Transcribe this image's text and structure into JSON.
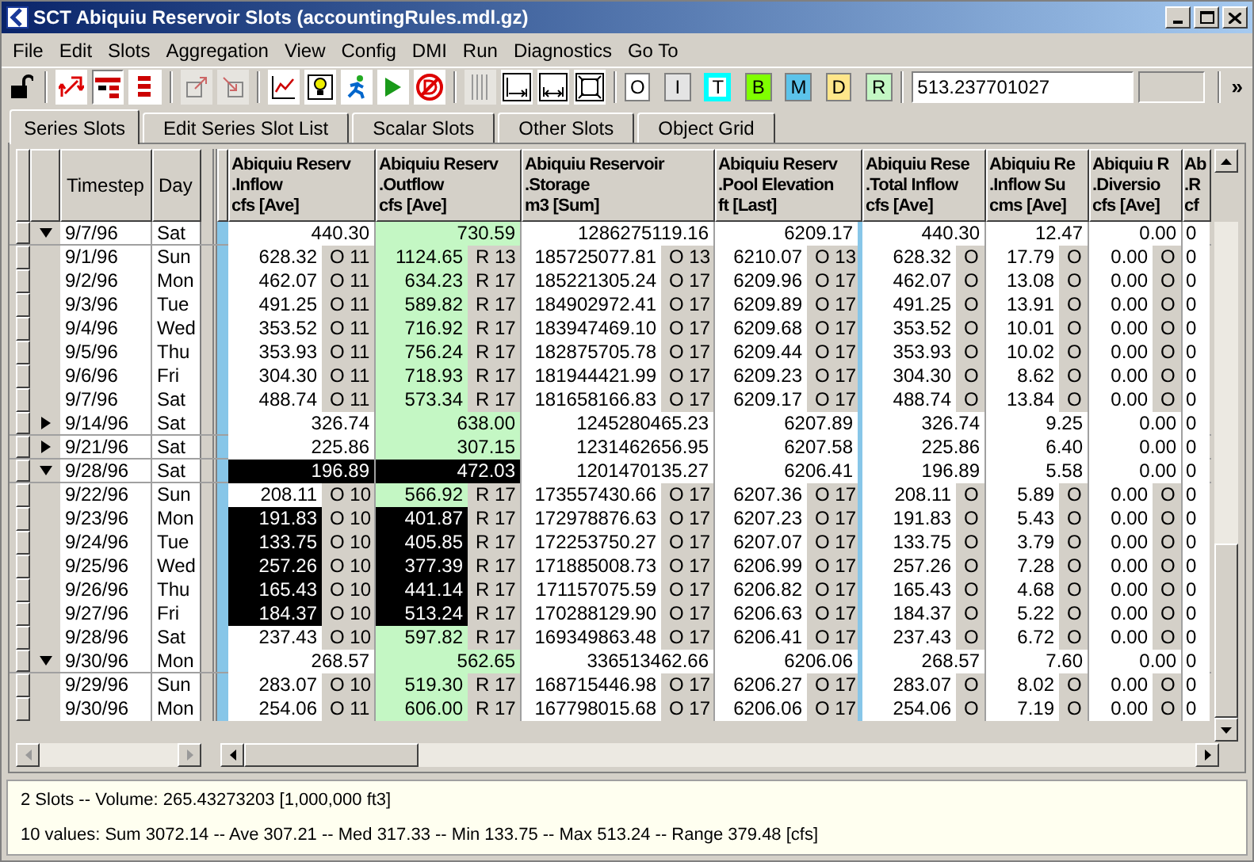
{
  "window": {
    "title": "SCT Abiquiu Reservoir Slots (accountingRules.mdl.gz)"
  },
  "menu": [
    "File",
    "Edit",
    "Slots",
    "Aggregation",
    "View",
    "Config",
    "DMI",
    "Run",
    "Diagnostics",
    "Go To"
  ],
  "toolbar": {
    "flag_buttons": [
      {
        "label": "O",
        "kind": "fill",
        "color": "#ffffff"
      },
      {
        "label": "I",
        "kind": "fill",
        "color": "#e4e4e4"
      },
      {
        "label": "T",
        "kind": "outline",
        "color": "#00ffff"
      },
      {
        "label": "B",
        "kind": "fill",
        "color": "#80ff00"
      },
      {
        "label": "M",
        "kind": "fill",
        "color": "#5cc3ea"
      },
      {
        "label": "D",
        "kind": "fill",
        "color": "#ffe68a"
      },
      {
        "label": "R",
        "kind": "fill",
        "color": "#c4f7c4"
      }
    ],
    "value": "513.237701027",
    "more": "»"
  },
  "tabs": [
    {
      "label": "Series Slots",
      "selected": true
    },
    {
      "label": "Edit Series Slot List",
      "selected": false
    },
    {
      "label": "Scalar Slots",
      "selected": false
    },
    {
      "label": "Other Slots",
      "selected": false
    },
    {
      "label": "Object Grid",
      "selected": false
    }
  ],
  "table": {
    "fixed_columns": [
      "Timestep",
      "Day"
    ],
    "columns": [
      {
        "lines": [
          "Abiquiu Reserv",
          ".Inflow",
          "cfs [Ave]"
        ],
        "highlighted": false
      },
      {
        "lines": [
          "Abiquiu Reserv",
          ".Outflow",
          "cfs [Ave]"
        ],
        "highlighted": true
      },
      {
        "lines": [
          "Abiquiu Reservoir",
          ".Storage",
          "m3 [Sum]"
        ],
        "highlighted": false
      },
      {
        "lines": [
          "Abiquiu Reserv",
          ".Pool Elevation",
          "ft [Last]"
        ],
        "highlighted": false
      },
      {
        "lines": [
          "Abiquiu Rese",
          ".Total Inflow",
          "cfs [Ave]"
        ],
        "highlighted": false
      },
      {
        "lines": [
          "Abiquiu Re",
          ".Inflow Su",
          "cms [Ave]"
        ],
        "highlighted": false
      },
      {
        "lines": [
          "Abiquiu R",
          ".Diversio",
          "cfs [Ave]"
        ],
        "highlighted": false
      },
      {
        "lines": [
          "Ab",
          ".R",
          "cf"
        ],
        "highlighted": false
      }
    ],
    "rows": [
      {
        "kind": "summary",
        "expanded": true,
        "timestep": "9/7/96",
        "day": "Sat",
        "cells": [
          {
            "value": "440.30",
            "selected": false
          },
          {
            "value": "730.59",
            "selected": false
          },
          {
            "value": "1286275119.16",
            "selected": false
          },
          {
            "value": "6209.17",
            "selected": false
          },
          {
            "value": "440.30",
            "selected": false
          },
          {
            "value": "12.47",
            "selected": false
          },
          {
            "value": "0.00",
            "selected": false
          },
          {
            "value": "0",
            "selected": false
          }
        ]
      },
      {
        "kind": "detail",
        "timestep": "9/1/96",
        "day": "Sun",
        "cells": [
          {
            "value": "628.32",
            "flag": "O 11",
            "selected": false
          },
          {
            "value": "1124.65",
            "flag": "R 13",
            "selected": false
          },
          {
            "value": "185725077.81",
            "flag": "O 13",
            "selected": false
          },
          {
            "value": "6210.07",
            "flag": "O 13",
            "selected": false
          },
          {
            "value": "628.32",
            "flag": "O",
            "selected": false
          },
          {
            "value": "17.79",
            "flag": "O",
            "selected": false
          },
          {
            "value": "0.00",
            "flag": "O",
            "selected": false
          },
          {
            "value": "0",
            "selected": false
          }
        ]
      },
      {
        "kind": "detail",
        "timestep": "9/2/96",
        "day": "Mon",
        "cells": [
          {
            "value": "462.07",
            "flag": "O 11",
            "selected": false
          },
          {
            "value": "634.23",
            "flag": "R 17",
            "selected": false
          },
          {
            "value": "185221305.24",
            "flag": "O 17",
            "selected": false
          },
          {
            "value": "6209.96",
            "flag": "O 17",
            "selected": false
          },
          {
            "value": "462.07",
            "flag": "O",
            "selected": false
          },
          {
            "value": "13.08",
            "flag": "O",
            "selected": false
          },
          {
            "value": "0.00",
            "flag": "O",
            "selected": false
          },
          {
            "value": "0",
            "selected": false
          }
        ]
      },
      {
        "kind": "detail",
        "timestep": "9/3/96",
        "day": "Tue",
        "cells": [
          {
            "value": "491.25",
            "flag": "O 11",
            "selected": false
          },
          {
            "value": "589.82",
            "flag": "R 17",
            "selected": false
          },
          {
            "value": "184902972.41",
            "flag": "O 17",
            "selected": false
          },
          {
            "value": "6209.89",
            "flag": "O 17",
            "selected": false
          },
          {
            "value": "491.25",
            "flag": "O",
            "selected": false
          },
          {
            "value": "13.91",
            "flag": "O",
            "selected": false
          },
          {
            "value": "0.00",
            "flag": "O",
            "selected": false
          },
          {
            "value": "0",
            "selected": false
          }
        ]
      },
      {
        "kind": "detail",
        "timestep": "9/4/96",
        "day": "Wed",
        "cells": [
          {
            "value": "353.52",
            "flag": "O 11",
            "selected": false
          },
          {
            "value": "716.92",
            "flag": "R 17",
            "selected": false
          },
          {
            "value": "183947469.10",
            "flag": "O 17",
            "selected": false
          },
          {
            "value": "6209.68",
            "flag": "O 17",
            "selected": false
          },
          {
            "value": "353.52",
            "flag": "O",
            "selected": false
          },
          {
            "value": "10.01",
            "flag": "O",
            "selected": false
          },
          {
            "value": "0.00",
            "flag": "O",
            "selected": false
          },
          {
            "value": "0",
            "selected": false
          }
        ]
      },
      {
        "kind": "detail",
        "timestep": "9/5/96",
        "day": "Thu",
        "cells": [
          {
            "value": "353.93",
            "flag": "O 11",
            "selected": false
          },
          {
            "value": "756.24",
            "flag": "R 17",
            "selected": false
          },
          {
            "value": "182875705.78",
            "flag": "O 17",
            "selected": false
          },
          {
            "value": "6209.44",
            "flag": "O 17",
            "selected": false
          },
          {
            "value": "353.93",
            "flag": "O",
            "selected": false
          },
          {
            "value": "10.02",
            "flag": "O",
            "selected": false
          },
          {
            "value": "0.00",
            "flag": "O",
            "selected": false
          },
          {
            "value": "0",
            "selected": false
          }
        ]
      },
      {
        "kind": "detail",
        "timestep": "9/6/96",
        "day": "Fri",
        "cells": [
          {
            "value": "304.30",
            "flag": "O 11",
            "selected": false
          },
          {
            "value": "718.93",
            "flag": "R 17",
            "selected": false
          },
          {
            "value": "181944421.99",
            "flag": "O 17",
            "selected": false
          },
          {
            "value": "6209.23",
            "flag": "O 17",
            "selected": false
          },
          {
            "value": "304.30",
            "flag": "O",
            "selected": false
          },
          {
            "value": "8.62",
            "flag": "O",
            "selected": false
          },
          {
            "value": "0.00",
            "flag": "O",
            "selected": false
          },
          {
            "value": "0",
            "selected": false
          }
        ]
      },
      {
        "kind": "detail",
        "timestep": "9/7/96",
        "day": "Sat",
        "cells": [
          {
            "value": "488.74",
            "flag": "O 11",
            "selected": false
          },
          {
            "value": "573.34",
            "flag": "R 17",
            "selected": false
          },
          {
            "value": "181658166.83",
            "flag": "O 17",
            "selected": false
          },
          {
            "value": "6209.17",
            "flag": "O 17",
            "selected": false
          },
          {
            "value": "488.74",
            "flag": "O",
            "selected": false
          },
          {
            "value": "13.84",
            "flag": "O",
            "selected": false
          },
          {
            "value": "0.00",
            "flag": "O",
            "selected": false
          },
          {
            "value": "0",
            "selected": false
          }
        ]
      },
      {
        "kind": "summary",
        "expanded": false,
        "timestep": "9/14/96",
        "day": "Sat",
        "cells": [
          {
            "value": "326.74",
            "selected": false
          },
          {
            "value": "638.00",
            "selected": false
          },
          {
            "value": "1245280465.23",
            "selected": false
          },
          {
            "value": "6207.89",
            "selected": false
          },
          {
            "value": "326.74",
            "selected": false
          },
          {
            "value": "9.25",
            "selected": false
          },
          {
            "value": "0.00",
            "selected": false
          },
          {
            "value": "0",
            "selected": false
          }
        ]
      },
      {
        "kind": "summary",
        "expanded": false,
        "timestep": "9/21/96",
        "day": "Sat",
        "cells": [
          {
            "value": "225.86",
            "selected": false
          },
          {
            "value": "307.15",
            "selected": false
          },
          {
            "value": "1231462656.95",
            "selected": false
          },
          {
            "value": "6207.58",
            "selected": false
          },
          {
            "value": "225.86",
            "selected": false
          },
          {
            "value": "6.40",
            "selected": false
          },
          {
            "value": "0.00",
            "selected": false
          },
          {
            "value": "0",
            "selected": false
          }
        ]
      },
      {
        "kind": "summary",
        "expanded": true,
        "timestep": "9/28/96",
        "day": "Sat",
        "cells": [
          {
            "value": "196.89",
            "selected": true
          },
          {
            "value": "472.03",
            "selected": true
          },
          {
            "value": "1201470135.27",
            "selected": false
          },
          {
            "value": "6206.41",
            "selected": false
          },
          {
            "value": "196.89",
            "selected": false
          },
          {
            "value": "5.58",
            "selected": false
          },
          {
            "value": "0.00",
            "selected": false
          },
          {
            "value": "0",
            "selected": false
          }
        ]
      },
      {
        "kind": "detail",
        "timestep": "9/22/96",
        "day": "Sun",
        "cells": [
          {
            "value": "208.11",
            "flag": "O 10",
            "selected": false
          },
          {
            "value": "566.92",
            "flag": "R 17",
            "selected": false
          },
          {
            "value": "173557430.66",
            "flag": "O 17",
            "selected": false
          },
          {
            "value": "6207.36",
            "flag": "O 17",
            "selected": false
          },
          {
            "value": "208.11",
            "flag": "O",
            "selected": false
          },
          {
            "value": "5.89",
            "flag": "O",
            "selected": false
          },
          {
            "value": "0.00",
            "flag": "O",
            "selected": false
          },
          {
            "value": "0",
            "selected": false
          }
        ]
      },
      {
        "kind": "detail",
        "timestep": "9/23/96",
        "day": "Mon",
        "cells": [
          {
            "value": "191.83",
            "flag": "O 10",
            "selected": true
          },
          {
            "value": "401.87",
            "flag": "R 17",
            "selected": true
          },
          {
            "value": "172978876.63",
            "flag": "O 17",
            "selected": false
          },
          {
            "value": "6207.23",
            "flag": "O 17",
            "selected": false
          },
          {
            "value": "191.83",
            "flag": "O",
            "selected": false
          },
          {
            "value": "5.43",
            "flag": "O",
            "selected": false
          },
          {
            "value": "0.00",
            "flag": "O",
            "selected": false
          },
          {
            "value": "0",
            "selected": false
          }
        ]
      },
      {
        "kind": "detail",
        "timestep": "9/24/96",
        "day": "Tue",
        "cells": [
          {
            "value": "133.75",
            "flag": "O 10",
            "selected": true
          },
          {
            "value": "405.85",
            "flag": "R 17",
            "selected": true
          },
          {
            "value": "172253750.27",
            "flag": "O 17",
            "selected": false
          },
          {
            "value": "6207.07",
            "flag": "O 17",
            "selected": false
          },
          {
            "value": "133.75",
            "flag": "O",
            "selected": false
          },
          {
            "value": "3.79",
            "flag": "O",
            "selected": false
          },
          {
            "value": "0.00",
            "flag": "O",
            "selected": false
          },
          {
            "value": "0",
            "selected": false
          }
        ]
      },
      {
        "kind": "detail",
        "timestep": "9/25/96",
        "day": "Wed",
        "cells": [
          {
            "value": "257.26",
            "flag": "O 10",
            "selected": true
          },
          {
            "value": "377.39",
            "flag": "R 17",
            "selected": true
          },
          {
            "value": "171885008.73",
            "flag": "O 17",
            "selected": false
          },
          {
            "value": "6206.99",
            "flag": "O 17",
            "selected": false
          },
          {
            "value": "257.26",
            "flag": "O",
            "selected": false
          },
          {
            "value": "7.28",
            "flag": "O",
            "selected": false
          },
          {
            "value": "0.00",
            "flag": "O",
            "selected": false
          },
          {
            "value": "0",
            "selected": false
          }
        ]
      },
      {
        "kind": "detail",
        "timestep": "9/26/96",
        "day": "Thu",
        "cells": [
          {
            "value": "165.43",
            "flag": "O 10",
            "selected": true
          },
          {
            "value": "441.14",
            "flag": "R 17",
            "selected": true
          },
          {
            "value": "171157075.59",
            "flag": "O 17",
            "selected": false
          },
          {
            "value": "6206.82",
            "flag": "O 17",
            "selected": false
          },
          {
            "value": "165.43",
            "flag": "O",
            "selected": false
          },
          {
            "value": "4.68",
            "flag": "O",
            "selected": false
          },
          {
            "value": "0.00",
            "flag": "O",
            "selected": false
          },
          {
            "value": "0",
            "selected": false
          }
        ]
      },
      {
        "kind": "detail",
        "timestep": "9/27/96",
        "day": "Fri",
        "cells": [
          {
            "value": "184.37",
            "flag": "O 10",
            "selected": true
          },
          {
            "value": "513.24",
            "flag": "R 17",
            "selected": true
          },
          {
            "value": "170288129.90",
            "flag": "O 17",
            "selected": false
          },
          {
            "value": "6206.63",
            "flag": "O 17",
            "selected": false
          },
          {
            "value": "184.37",
            "flag": "O",
            "selected": false
          },
          {
            "value": "5.22",
            "flag": "O",
            "selected": false
          },
          {
            "value": "0.00",
            "flag": "O",
            "selected": false
          },
          {
            "value": "0",
            "selected": false
          }
        ]
      },
      {
        "kind": "detail",
        "timestep": "9/28/96",
        "day": "Sat",
        "cells": [
          {
            "value": "237.43",
            "flag": "O 10",
            "selected": false
          },
          {
            "value": "597.82",
            "flag": "R 17",
            "selected": false
          },
          {
            "value": "169349863.48",
            "flag": "O 17",
            "selected": false
          },
          {
            "value": "6206.41",
            "flag": "O 17",
            "selected": false
          },
          {
            "value": "237.43",
            "flag": "O",
            "selected": false
          },
          {
            "value": "6.72",
            "flag": "O",
            "selected": false
          },
          {
            "value": "0.00",
            "flag": "O",
            "selected": false
          },
          {
            "value": "0",
            "selected": false
          }
        ]
      },
      {
        "kind": "summary",
        "expanded": true,
        "timestep": "9/30/96",
        "day": "Mon",
        "cells": [
          {
            "value": "268.57",
            "selected": false
          },
          {
            "value": "562.65",
            "selected": false
          },
          {
            "value": "336513462.66",
            "selected": false
          },
          {
            "value": "6206.06",
            "selected": false
          },
          {
            "value": "268.57",
            "selected": false
          },
          {
            "value": "7.60",
            "selected": false
          },
          {
            "value": "0.00",
            "selected": false
          },
          {
            "value": "0",
            "selected": false
          }
        ]
      },
      {
        "kind": "detail",
        "timestep": "9/29/96",
        "day": "Sun",
        "cells": [
          {
            "value": "283.07",
            "flag": "O 10",
            "selected": false
          },
          {
            "value": "519.30",
            "flag": "R 17",
            "selected": false
          },
          {
            "value": "168715446.98",
            "flag": "O 17",
            "selected": false
          },
          {
            "value": "6206.27",
            "flag": "O 17",
            "selected": false
          },
          {
            "value": "283.07",
            "flag": "O",
            "selected": false
          },
          {
            "value": "8.02",
            "flag": "O",
            "selected": false
          },
          {
            "value": "0.00",
            "flag": "O",
            "selected": false
          },
          {
            "value": "0",
            "selected": false
          }
        ]
      },
      {
        "kind": "detail",
        "timestep": "9/30/96",
        "day": "Mon",
        "cells": [
          {
            "value": "254.06",
            "flag": "O 11",
            "selected": false
          },
          {
            "value": "606.00",
            "flag": "R 17",
            "selected": false
          },
          {
            "value": "167798015.68",
            "flag": "O 17",
            "selected": false
          },
          {
            "value": "6206.06",
            "flag": "O 17",
            "selected": false
          },
          {
            "value": "254.06",
            "flag": "O",
            "selected": false
          },
          {
            "value": "7.19",
            "flag": "O",
            "selected": false
          },
          {
            "value": "0.00",
            "flag": "O",
            "selected": false
          },
          {
            "value": "0",
            "selected": false
          }
        ]
      }
    ]
  },
  "status_bar": [
    "2 Slots -- Volume: 265.43273203 [1,000,000 ft3]",
    "10 values:  Sum 3072.14 -- Ave 307.21 -- Med 317.33 -- Min 133.75 -- Max 513.24 -- Range 379.48 [cfs]"
  ]
}
